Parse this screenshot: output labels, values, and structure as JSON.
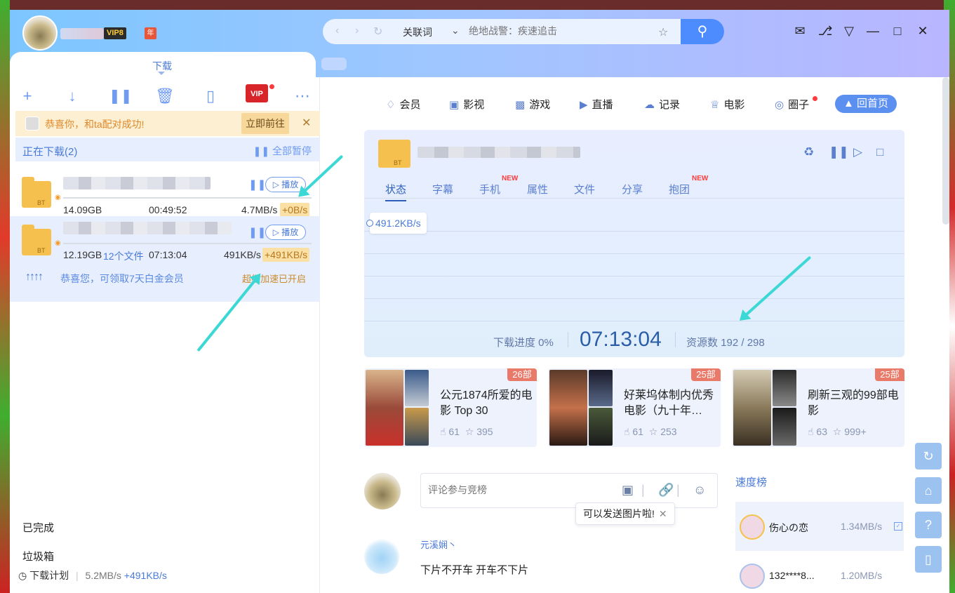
{
  "header": {
    "vip_badge": "VIP8",
    "year_badge": "年",
    "search": {
      "type": "关联词",
      "placeholder": "绝地战警：疾速追击"
    }
  },
  "tab": {
    "label": "下载"
  },
  "toolbar": {
    "vip_label": "VIP"
  },
  "notice": {
    "text": "恭喜你，和ta配对成功!",
    "action": "立即前往"
  },
  "downloading": {
    "title": "正在下载(2)",
    "pause_all": "全部暂停",
    "tasks": [
      {
        "size": "14.09GB",
        "time": "00:49:52",
        "speed": "4.7MB/s",
        "boost": "+0B/s",
        "play_label": "播放"
      },
      {
        "size": "12.19GB",
        "files": "12个文件",
        "time": "07:13:04",
        "speed": "491KB/s",
        "boost": "+491KB/s",
        "play_label": "播放",
        "promo": "恭喜您，可领取7天白金会员",
        "promo_right": "超级加速已开启"
      }
    ]
  },
  "left_links": {
    "completed": "已完成",
    "trash": "垃圾箱"
  },
  "footer": {
    "plan": "下载计划",
    "speed": "5.2MB/s",
    "boost": "+491KB/s"
  },
  "nav": {
    "items": [
      "会员",
      "影视",
      "游戏",
      "直播",
      "记录",
      "电影",
      "圈子"
    ],
    "home": "回首页"
  },
  "status_card": {
    "tabs": [
      "状态",
      "字幕",
      "手机",
      "属性",
      "文件",
      "分享",
      "抱团"
    ],
    "new_badge": "NEW",
    "speed_label": "491.2KB/s",
    "progress_label": "下载进度 0%",
    "time": "07:13:04",
    "resources": "资源数 192 / 298"
  },
  "recommendations": [
    {
      "title": "公元1874所爱的电影 Top 30",
      "count": "26部",
      "likes": "61",
      "stars": "395"
    },
    {
      "title": "好莱坞体制内优秀电影（九十年…",
      "count": "25部",
      "likes": "61",
      "stars": "253"
    },
    {
      "title": "刷新三观的99部电影",
      "count": "25部",
      "likes": "63",
      "stars": "999+"
    }
  ],
  "comments": {
    "placeholder": "评论参与竞榜",
    "tooltip": "可以发送图片啦!",
    "first": {
      "name": "元溪娴丶",
      "text": "下片不开车 开车不下片"
    }
  },
  "ranking": {
    "title": "速度榜",
    "rows": [
      {
        "name": "伤心の恋",
        "speed": "1.34MB/s"
      },
      {
        "name": "132****8...",
        "speed": "1.20MB/s"
      }
    ]
  },
  "colors": {
    "accent": "#4a7ad8",
    "header_start": "#7cc6ff",
    "header_end": "#b9b6ff",
    "notice_bg": "#fdf0d2",
    "annotation_arrow": "#3cd8d6"
  }
}
